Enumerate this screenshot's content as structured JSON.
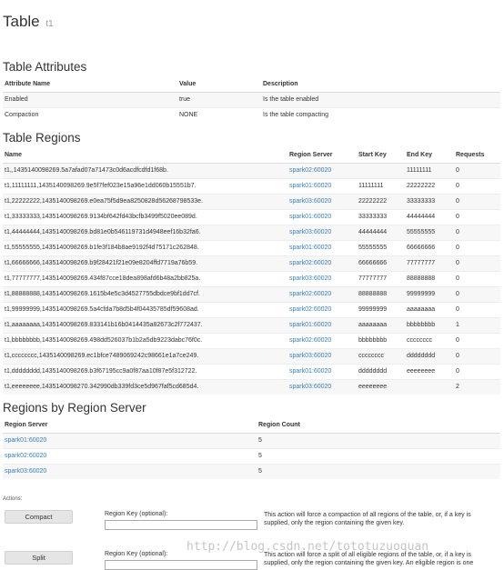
{
  "page": {
    "title": "Table",
    "table_name": "t1"
  },
  "attributes": {
    "title": "Table Attributes",
    "headers": [
      "Attribute Name",
      "Value",
      "Description"
    ],
    "rows": [
      [
        "Enabled",
        "true",
        "Is the table enabled"
      ],
      [
        "Compaction",
        "NONE",
        "Is the table compacting"
      ]
    ]
  },
  "regions": {
    "title": "Table Regions",
    "headers": [
      "Name",
      "Region Server",
      "Start Key",
      "End Key",
      "Requests"
    ],
    "rows": [
      [
        "t1,,1435140098269.5a7afad07a71473c0d6acdfcdfd1f68b.",
        "spark02:60020",
        "",
        "11111111",
        "0"
      ],
      [
        "t1,11111111,1435140098269.9e5f7fef023e15a96e1dd060b15551b7.",
        "spark01:60020",
        "11111111",
        "22222222",
        "0"
      ],
      [
        "t1,22222222,1435140098269.e0ea75f5d9ea8250828d56268798533e.",
        "spark03:60020",
        "22222222",
        "33333333",
        "0"
      ],
      [
        "t1,33333333,1435140098269.9134bf642fd43bcfb3499f5020ee089d.",
        "spark01:60020",
        "33333333",
        "44444444",
        "0"
      ],
      [
        "t1,44444444,1435140098269.bd81e0b546119731d4948eef16b32fa6.",
        "spark03:60020",
        "44444444",
        "55555555",
        "0"
      ],
      [
        "t1,55555555,1435140098269.b1fe3f184b8ae9192f4d75171c262848.",
        "spark01:60020",
        "55555555",
        "66666666",
        "0"
      ],
      [
        "t1,66666666,1435140098269.b9f28421f21e09e8204ffd7719a76b59.",
        "spark02:60020",
        "66666666",
        "77777777",
        "0"
      ],
      [
        "t1,77777777,1435140098269.434f87cce18dea898afd6b48a2bb825a.",
        "spark03:60020",
        "77777777",
        "88888888",
        "0"
      ],
      [
        "t1,88888888,1435140098269.1615b4e5c3d4527755dbdce9bf1dd7cf.",
        "spark02:60020",
        "88888888",
        "99999999",
        "0"
      ],
      [
        "t1,99999999,1435140098269.5a4cfda7b8d5b4f04435785df59608ad.",
        "spark02:60020",
        "99999999",
        "aaaaaaaa",
        "0"
      ],
      [
        "t1,aaaaaaaa,1435140098269.833141b16b0414435a82673c2f772437.",
        "spark01:60020",
        "aaaaaaaa",
        "bbbbbbbb",
        "1"
      ],
      [
        "t1,bbbbbbbb,1435140098269.498dd526037b1b2a5db9223dabc76f0c.",
        "spark02:60020",
        "bbbbbbbb",
        "cccccccc",
        "0"
      ],
      [
        "t1,cccccccc,1435140098269.ec1bfce7489069242c98661e1a7ce249.",
        "spark03:60020",
        "cccccccc",
        "dddddddd",
        "0"
      ],
      [
        "t1,dddddddd,1435140098269.b3f67195cc9a0f87aa10f87e5f312722.",
        "spark01:60020",
        "dddddddd",
        "eeeeeeee",
        "0"
      ],
      [
        "t1,eeeeeeee,1435140098270.342990db339fd3ce5d967faf5cd685d4.",
        "spark03:60020",
        "eeeeeeee",
        "",
        "2"
      ]
    ]
  },
  "by_server": {
    "title": "Regions by Region Server",
    "headers": [
      "Region Server",
      "Region Count"
    ],
    "rows": [
      [
        "spark01:60020",
        "5"
      ],
      [
        "spark02:60020",
        "5"
      ],
      [
        "spark03:60020",
        "5"
      ]
    ]
  },
  "actions": {
    "label": "Actions:",
    "compact": {
      "button": "Compact",
      "field_label": "Region Key (optional):",
      "field_value": "",
      "description": "This action will force a compaction of all regions of the table, or, if a key is supplied, only the region containing the given key."
    },
    "split": {
      "button": "Split",
      "field_label": "Region Key (optional):",
      "field_value": "",
      "description": "This action will force a split of all eligible regions of the table, or, if a key is supplied, only the region containing the given key. An eligible region is one"
    }
  },
  "watermark": "http://blog.csdn.net/tototuzuoquan",
  "colors": {
    "link": "#3a7fc1",
    "stripe": "#f7f7f7",
    "button": "#e5e5e5"
  }
}
